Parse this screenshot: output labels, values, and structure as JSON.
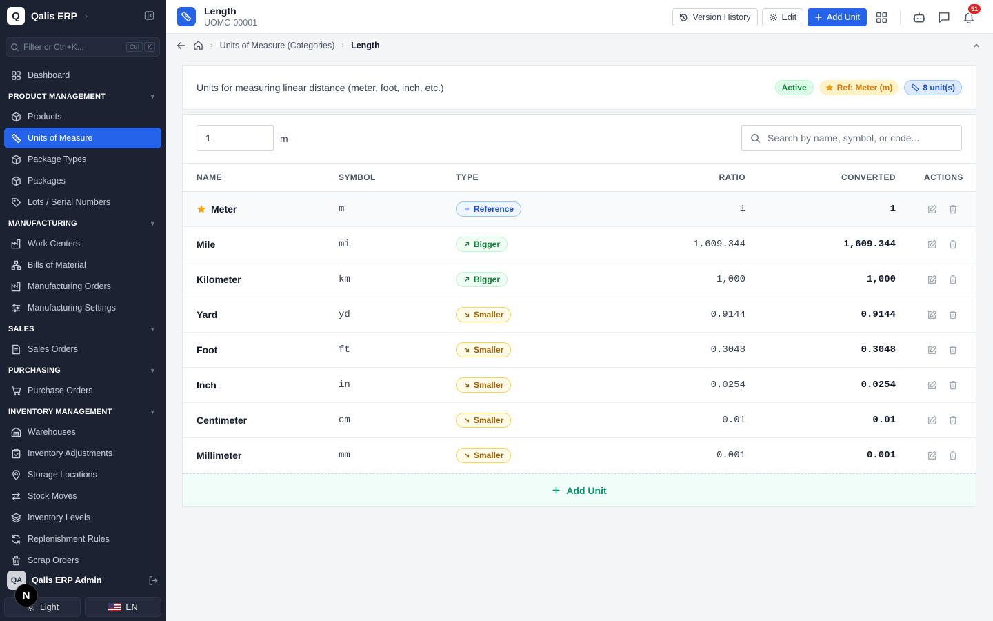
{
  "app": {
    "name": "Qalis ERP",
    "logo_letter": "Q"
  },
  "sidebar": {
    "filter_placeholder": "Filter or Ctrl+K...",
    "kbd": [
      "Ctrl",
      "K"
    ],
    "top_items": [
      {
        "label": "Dashboard",
        "icon": "grid-icon"
      }
    ],
    "sections": [
      {
        "title": "PRODUCT MANAGEMENT",
        "items": [
          {
            "label": "Products",
            "icon": "box-icon"
          },
          {
            "label": "Units of Measure",
            "icon": "ruler-icon",
            "active": true
          },
          {
            "label": "Package Types",
            "icon": "box-icon"
          },
          {
            "label": "Packages",
            "icon": "box-icon"
          },
          {
            "label": "Lots / Serial Numbers",
            "icon": "tag-icon"
          }
        ]
      },
      {
        "title": "MANUFACTURING",
        "items": [
          {
            "label": "Work Centers",
            "icon": "factory-icon"
          },
          {
            "label": "Bills of Material",
            "icon": "hierarchy-icon"
          },
          {
            "label": "Manufacturing Orders",
            "icon": "factory-icon"
          },
          {
            "label": "Manufacturing Settings",
            "icon": "sliders-icon"
          }
        ]
      },
      {
        "title": "SALES",
        "items": [
          {
            "label": "Sales Orders",
            "icon": "document-icon"
          }
        ]
      },
      {
        "title": "PURCHASING",
        "items": [
          {
            "label": "Purchase Orders",
            "icon": "cart-icon"
          }
        ]
      },
      {
        "title": "INVENTORY MANAGEMENT",
        "items": [
          {
            "label": "Warehouses",
            "icon": "warehouse-icon"
          },
          {
            "label": "Inventory Adjustments",
            "icon": "clipboard-icon"
          },
          {
            "label": "Storage Locations",
            "icon": "pin-icon"
          },
          {
            "label": "Stock Moves",
            "icon": "arrows-icon"
          },
          {
            "label": "Inventory Levels",
            "icon": "layers-icon"
          },
          {
            "label": "Replenishment Rules",
            "icon": "refresh-icon"
          },
          {
            "label": "Scrap Orders",
            "icon": "trash-icon"
          }
        ]
      }
    ],
    "user": {
      "initials": "QA",
      "name": "Qalis ERP Admin"
    },
    "theme_label": "Light",
    "lang_label": "EN",
    "n_badge": "N"
  },
  "header": {
    "title": "Length",
    "code": "UOMC-00001",
    "version_history": "Version History",
    "edit": "Edit",
    "add_unit": "Add Unit",
    "notification_count": "51"
  },
  "breadcrumb": {
    "parent": "Units of Measure (Categories)",
    "current": "Length"
  },
  "category": {
    "description": "Units for measuring linear distance (meter, foot, inch, etc.)",
    "status": "Active",
    "reference": "Ref: Meter (m)",
    "unit_count": "8 unit(s)"
  },
  "converter": {
    "quantity": "1",
    "unit": "m",
    "search_placeholder": "Search by name, symbol, or code..."
  },
  "table": {
    "columns": {
      "name": "NAME",
      "symbol": "SYMBOL",
      "type": "TYPE",
      "ratio": "RATIO",
      "converted": "CONVERTED",
      "actions": "ACTIONS"
    },
    "rows": [
      {
        "name": "Meter",
        "symbol": "m",
        "type": "Reference",
        "ratio": "1",
        "converted": "1",
        "ref": true
      },
      {
        "name": "Mile",
        "symbol": "mi",
        "type": "Bigger",
        "ratio": "1,609.344",
        "converted": "1,609.344"
      },
      {
        "name": "Kilometer",
        "symbol": "km",
        "type": "Bigger",
        "ratio": "1,000",
        "converted": "1,000"
      },
      {
        "name": "Yard",
        "symbol": "yd",
        "type": "Smaller",
        "ratio": "0.9144",
        "converted": "0.9144"
      },
      {
        "name": "Foot",
        "symbol": "ft",
        "type": "Smaller",
        "ratio": "0.3048",
        "converted": "0.3048"
      },
      {
        "name": "Inch",
        "symbol": "in",
        "type": "Smaller",
        "ratio": "0.0254",
        "converted": "0.0254"
      },
      {
        "name": "Centimeter",
        "symbol": "cm",
        "type": "Smaller",
        "ratio": "0.01",
        "converted": "0.01"
      },
      {
        "name": "Millimeter",
        "symbol": "mm",
        "type": "Smaller",
        "ratio": "0.001",
        "converted": "0.001"
      }
    ],
    "add_unit_label": "Add Unit"
  },
  "colors": {
    "accent": "#2563eb",
    "sidebar_bg": "#1b2232",
    "success": "#15803d",
    "warning": "#d97706"
  }
}
